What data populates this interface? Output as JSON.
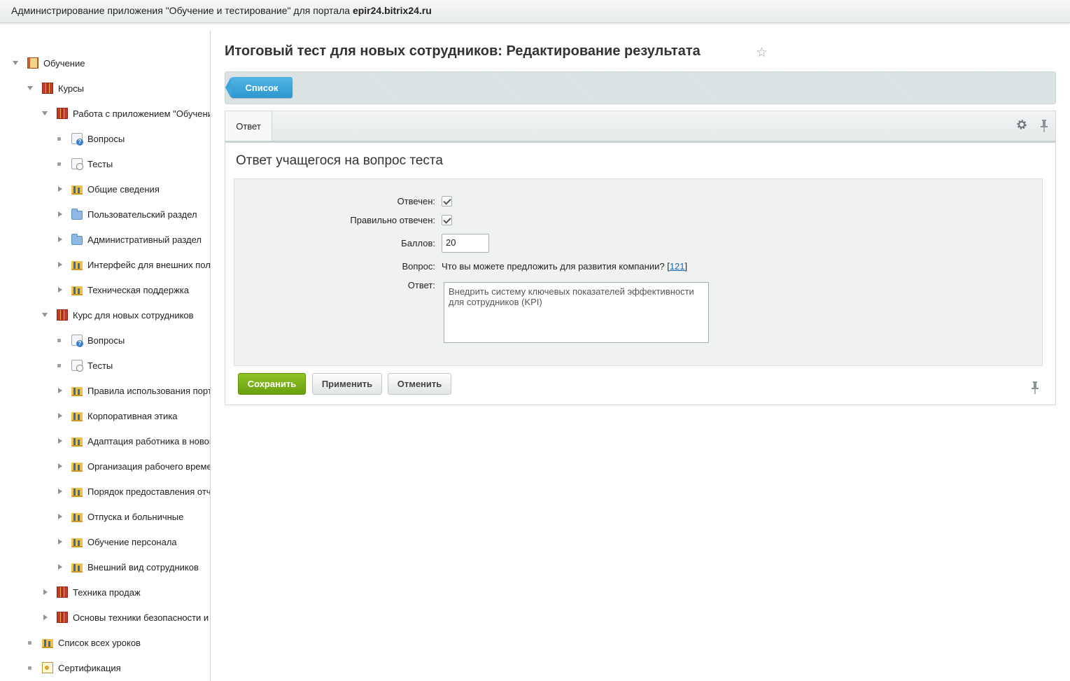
{
  "topbar": {
    "prefix": "Администрирование приложения \"Обучение и тестирование\" для портала ",
    "portal": "epir24.bitrix24.ru"
  },
  "tree": [
    {
      "label": "Обучение",
      "arrow": "down",
      "icon": "book"
    },
    {
      "label": "Курсы",
      "arrow": "down",
      "icon": "books"
    },
    {
      "label": "Работа с приложением \"Обучение и тестирование\"",
      "arrow": "down",
      "icon": "books"
    },
    {
      "label": "Вопросы",
      "arrow": "dot",
      "icon": "question"
    },
    {
      "label": "Тесты",
      "arrow": "dot",
      "icon": "test"
    },
    {
      "label": "Общие сведения",
      "arrow": "right",
      "icon": "chapter"
    },
    {
      "label": "Пользовательский раздел",
      "arrow": "right",
      "icon": "folder"
    },
    {
      "label": "Административный раздел",
      "arrow": "right",
      "icon": "folder"
    },
    {
      "label": "Интерфейс для внешних пользователей",
      "arrow": "right",
      "icon": "chapter"
    },
    {
      "label": "Техническая поддержка",
      "arrow": "right",
      "icon": "chapter"
    },
    {
      "label": "Курс для новых сотрудников",
      "arrow": "down",
      "icon": "books"
    },
    {
      "label": "Вопросы",
      "arrow": "dot",
      "icon": "question"
    },
    {
      "label": "Тесты",
      "arrow": "dot",
      "icon": "test"
    },
    {
      "label": "Правила использования портала",
      "arrow": "right",
      "icon": "chapter"
    },
    {
      "label": "Корпоративная этика",
      "arrow": "right",
      "icon": "chapter"
    },
    {
      "label": "Адаптация работника в новом коллективе",
      "arrow": "right",
      "icon": "chapter"
    },
    {
      "label": "Организация рабочего времени",
      "arrow": "right",
      "icon": "chapter"
    },
    {
      "label": "Порядок предоставления отчетности",
      "arrow": "right",
      "icon": "chapter"
    },
    {
      "label": "Отпуска и больничные",
      "arrow": "right",
      "icon": "chapter"
    },
    {
      "label": "Обучение персонала",
      "arrow": "right",
      "icon": "chapter"
    },
    {
      "label": "Внешний вид сотрудников",
      "arrow": "right",
      "icon": "chapter"
    },
    {
      "label": "Техника продаж",
      "arrow": "right",
      "icon": "books"
    },
    {
      "label": "Основы техники безопасности и охраны труда",
      "arrow": "right",
      "icon": "books"
    },
    {
      "label": "Список всех уроков",
      "arrow": "dot",
      "icon": "chapter"
    },
    {
      "label": "Сертификация",
      "arrow": "dot",
      "icon": "cert"
    }
  ],
  "page": {
    "title": "Итоговый тест для новых сотрудников: Редактирование результата",
    "list_button": "Список"
  },
  "tabs": {
    "active": "Ответ"
  },
  "section": {
    "title": "Ответ учащегося на вопрос теста"
  },
  "form": {
    "answered_label": "Отвечен:",
    "answered_checked": true,
    "correct_label": "Правильно отвечен:",
    "correct_checked": true,
    "score_label": "Баллов:",
    "score_value": "20",
    "question_label": "Вопрос:",
    "question_text": "Что вы можете предложить для развития компании?",
    "question_link_open": " [",
    "question_link": "121",
    "question_link_close": "]",
    "answer_label": "Ответ:",
    "answer_text": "Внедрить систему ключевых показателей эффективности\nдля сотрудников (KPI)"
  },
  "buttons": {
    "save": "Сохранить",
    "apply": "Применить",
    "cancel": "Отменить"
  },
  "colors": {
    "accent_blue": "#2c97cf",
    "save_green": "#6aa00f",
    "link": "#2067b0"
  }
}
